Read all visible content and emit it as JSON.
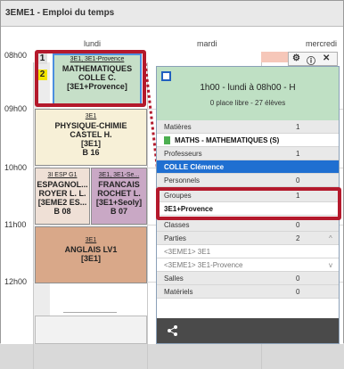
{
  "window": {
    "title": "3EME1 - Emploi du temps"
  },
  "days": {
    "d1": "lundi",
    "d2": "mardi",
    "d3": "mercredi"
  },
  "hours": [
    "08h00",
    "09h00",
    "10h00",
    "11h00",
    "12h00"
  ],
  "courses": {
    "math": {
      "groups": "3E1, 3E1-Provence",
      "title": "MATHEMATIQUES",
      "teacher": "COLLE C.",
      "group": "[3E1+Provence]"
    },
    "physique": {
      "groups": "3E1",
      "title": "PHYSIQUE-CHIMIE",
      "teacher": "CASTEL H.",
      "group": "[3E1]",
      "room": "B 16"
    },
    "espagnol": {
      "groups": "3I ESP G1",
      "title": "ESPAGNOL...",
      "teacher": "ROYER L. L.",
      "group": "[3EME2 ES...",
      "room": "B 08"
    },
    "francais": {
      "groups": "3E1, 3E1-Se...",
      "title": "FRANCAIS",
      "teacher": "ROCHET L.",
      "group": "[3E1+Seoly]",
      "room": "B 07"
    },
    "anglais": {
      "groups": "3E1",
      "title": "ANGLAIS LV1",
      "group": "[3E1]"
    }
  },
  "course_numbers": {
    "n1": "1",
    "n2": "2"
  },
  "popup": {
    "header_line1": "1h00 - lundi à 08h00 - H",
    "header_line2": "0 place libre - 27 élèves",
    "rows": {
      "matieres": {
        "label": "Matières",
        "count": "1"
      },
      "matiere_item": {
        "label": "MATHS - MATHEMATIQUES (S)"
      },
      "professeurs": {
        "label": "Professeurs",
        "count": "1"
      },
      "prof_item": {
        "label": "COLLE Clémence"
      },
      "personnels": {
        "label": "Personnels",
        "count": "0"
      },
      "groupes": {
        "label": "Groupes",
        "count": "1"
      },
      "groupe_item": {
        "label": "3E1+Provence"
      },
      "classes": {
        "label": "Classes",
        "count": "0"
      },
      "parties": {
        "label": "Parties",
        "count": "2"
      },
      "partie1": {
        "label": "<3EME1> 3E1"
      },
      "partie2": {
        "label": "<3EME1> 3E1-Provence"
      },
      "salles": {
        "label": "Salles",
        "count": "0"
      },
      "materiels": {
        "label": "Matériels",
        "count": "0"
      }
    }
  },
  "colors": {
    "accent_red": "#b4192c",
    "selection_blue": "#1f6fd1",
    "header_green": "#bfe0c4"
  }
}
